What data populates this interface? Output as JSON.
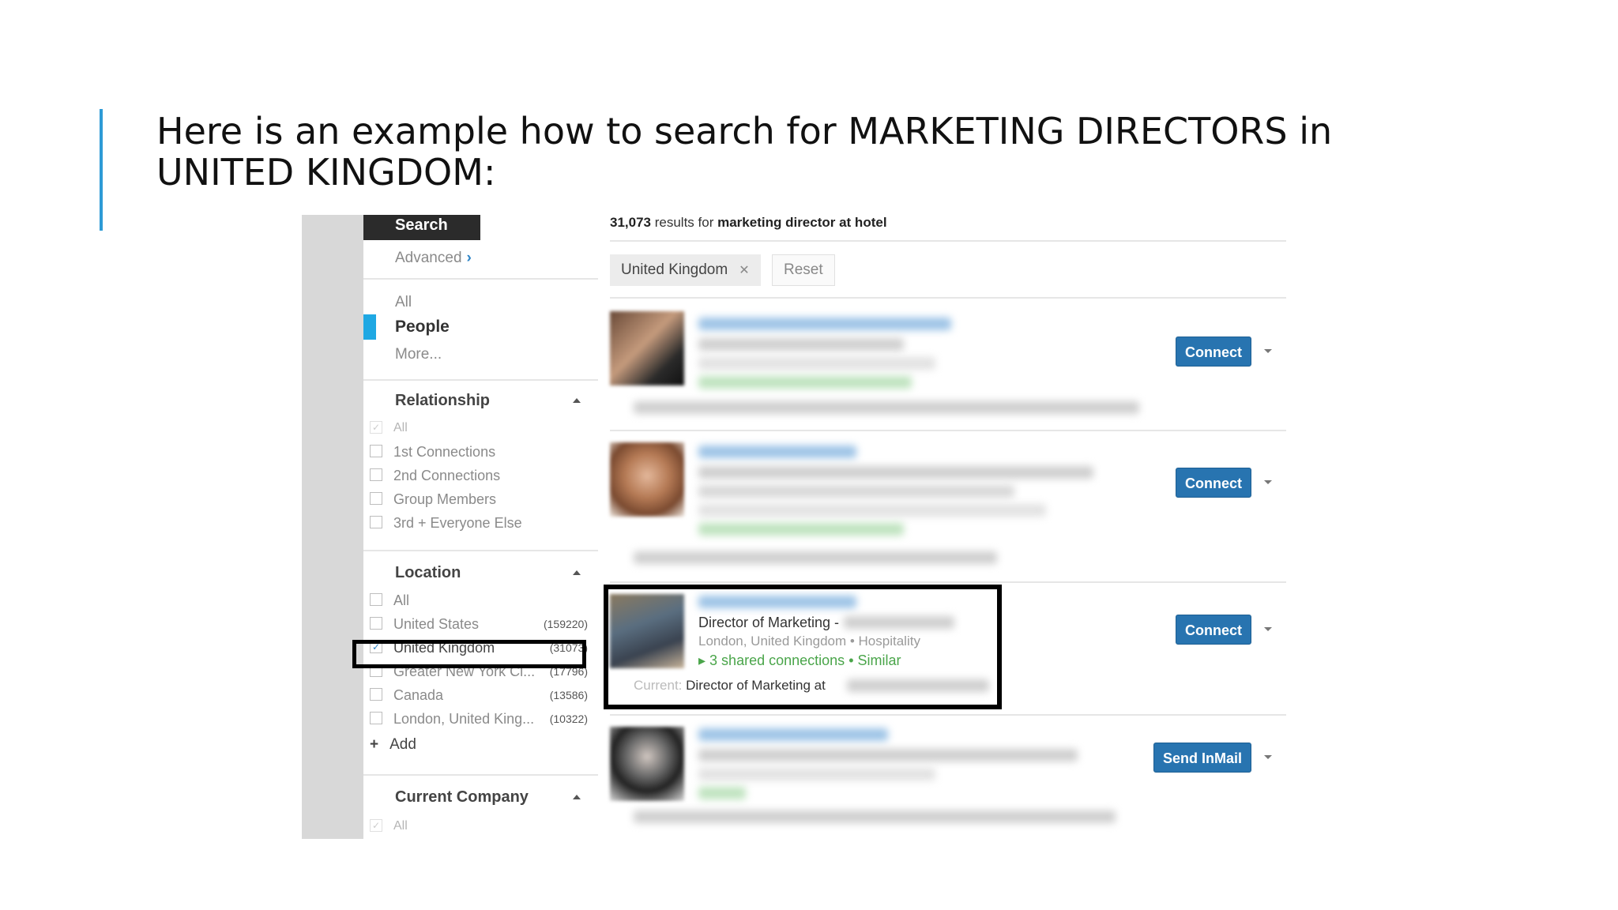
{
  "slide": {
    "title": "Here is an example how to search for MARKETING DIRECTORS in UNITED KINGDOM:"
  },
  "sidebar": {
    "search_label": "Search",
    "advanced_label": "Advanced",
    "nav": [
      {
        "label": "All",
        "active": false
      },
      {
        "label": "People",
        "active": true
      },
      {
        "label": "More...",
        "active": false
      }
    ],
    "relationship": {
      "heading": "Relationship",
      "options": [
        {
          "label": "All",
          "checked": true
        },
        {
          "label": "1st Connections",
          "checked": false
        },
        {
          "label": "2nd Connections",
          "checked": false
        },
        {
          "label": "Group Members",
          "checked": false
        },
        {
          "label": "3rd + Everyone Else",
          "checked": false
        }
      ]
    },
    "location": {
      "heading": "Location",
      "options": [
        {
          "label": "All",
          "count": "",
          "checked": false
        },
        {
          "label": "United States",
          "count": "(159220)",
          "checked": false
        },
        {
          "label": "United Kingdom",
          "count": "(31073)",
          "checked": true
        },
        {
          "label": "Greater New York Ci...",
          "count": "(17796)",
          "checked": false
        },
        {
          "label": "Canada",
          "count": "(13586)",
          "checked": false
        },
        {
          "label": "London, United King...",
          "count": "(10322)",
          "checked": false
        }
      ],
      "add_label": "Add"
    },
    "current_company": {
      "heading": "Current Company",
      "options": [
        {
          "label": "All",
          "checked": true
        }
      ]
    }
  },
  "results": {
    "count": "31,073",
    "results_for": "results for",
    "query": "marketing director at hotel",
    "filter_pill": "United Kingdom",
    "reset_label": "Reset",
    "items": [
      {
        "button": "Connect"
      },
      {
        "button": "Connect"
      },
      {
        "button": "Connect",
        "headline": "Director of Marketing -",
        "location": "London, United Kingdom • Hospitality",
        "shared_connections": "3 shared connections",
        "similar": "Similar",
        "current_label": "Current:",
        "current_value": "Director of Marketing at"
      },
      {
        "button": "Send InMail"
      }
    ]
  },
  "colors": {
    "accent": "#2e9bd6",
    "button_blue": "#2874b0",
    "active_marker": "#1fa8e3",
    "shared_green": "#4aa54a"
  }
}
